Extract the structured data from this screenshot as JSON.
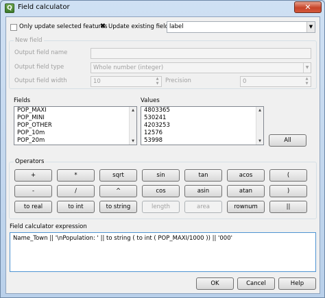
{
  "window": {
    "title": "Field calculator",
    "close_glyph": "✕",
    "app_icon": "Q"
  },
  "options": {
    "only_selected_label": "Only update selected features",
    "only_selected_checked": false,
    "update_existing_label": "Update existing field",
    "update_existing_checked": true,
    "existing_field_value": "label"
  },
  "new_field": {
    "group_title": "New field",
    "name_label": "Output field name",
    "name_value": "",
    "type_label": "Output field type",
    "type_value": "Whole number (integer)",
    "width_label": "Output field width",
    "width_value": "10",
    "precision_label": "Precision",
    "precision_value": "0"
  },
  "fields": {
    "label": "Fields",
    "items": [
      "POP_MAXI",
      "POP_MINI",
      "POP_OTHER",
      "POP_10m",
      "POP_20m"
    ]
  },
  "values": {
    "label": "Values",
    "items": [
      "4803365",
      "530241",
      "4203253",
      "12576",
      "53998"
    ],
    "all_button": "All"
  },
  "operators": {
    "group_title": "Operators",
    "rows": [
      [
        "+",
        "*",
        "sqrt",
        "sin",
        "tan",
        "acos",
        "("
      ],
      [
        "-",
        "/",
        "^",
        "cos",
        "asin",
        "atan",
        ")"
      ],
      [
        "to real",
        "to int",
        "to string",
        "length",
        "area",
        "rownum",
        "||"
      ]
    ]
  },
  "expression": {
    "label": "Field calculator expression",
    "text": "Name_Town || '\\nPopulation: ' ||  to string ( to int ( POP_MAXI/1000 )) || '000'"
  },
  "buttons": {
    "ok": "OK",
    "cancel": "Cancel",
    "help": "Help"
  },
  "icons": {
    "checked_glyph": "✖",
    "dropdown": "▼",
    "spin_up": "▲",
    "spin_down": "▼",
    "scroll_up": "▲",
    "scroll_down": "▼"
  }
}
